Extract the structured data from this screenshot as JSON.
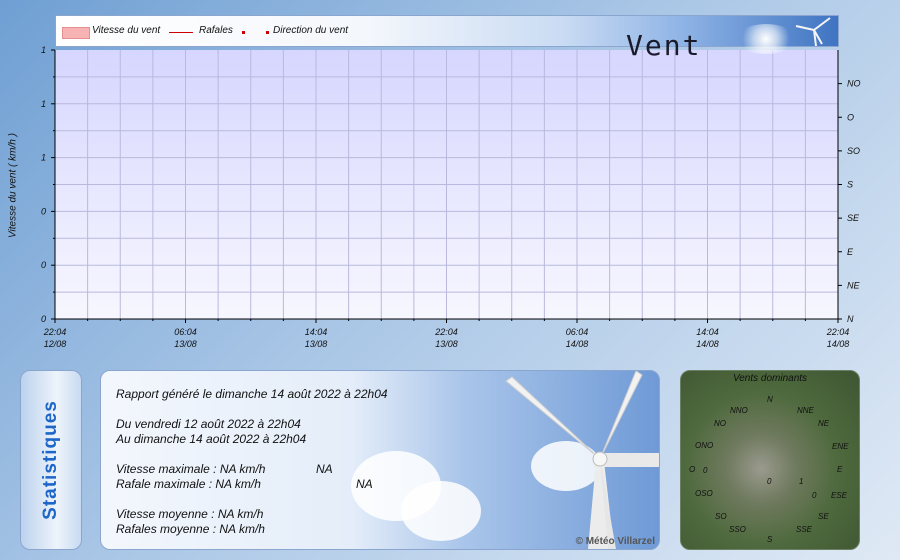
{
  "header": {
    "title": "Vent"
  },
  "legend": {
    "wind_speed": "Vitesse du vent",
    "gusts": "Rafales",
    "direction": "Direction du vent"
  },
  "colors": {
    "wind_speed": "#f7b3b3",
    "gusts": "#cc0000",
    "direction": "#cc0000",
    "plot_top": "#d6d6ff",
    "plot_bottom": "#f7f7ff"
  },
  "chart_data": {
    "type": "line",
    "ylabel": "Vitesse du vent ( km/h )",
    "left_ticks": [
      "0",
      "0",
      "0",
      "1",
      "1",
      "1"
    ],
    "right_ticks": [
      "N",
      "NE",
      "E",
      "SE",
      "S",
      "SO",
      "O",
      "NO"
    ],
    "x_ticks": [
      {
        "time": "22:04",
        "date": "12/08"
      },
      {
        "time": "06:04",
        "date": "13/08"
      },
      {
        "time": "14:04",
        "date": "13/08"
      },
      {
        "time": "22:04",
        "date": "13/08"
      },
      {
        "time": "06:04",
        "date": "14/08"
      },
      {
        "time": "14:04",
        "date": "14/08"
      },
      {
        "time": "22:04",
        "date": "14/08"
      }
    ],
    "series": [
      {
        "name": "Vitesse du vent",
        "values": []
      },
      {
        "name": "Rafales",
        "values": []
      },
      {
        "name": "Direction du vent",
        "values": []
      }
    ],
    "grid": true
  },
  "stats": {
    "side_label": "Statistiques",
    "generated": "Rapport généré le dimanche 14 août 2022 à 22h04",
    "from": "Du vendredi 12 août 2022 à 22h04",
    "to": "Au dimanche 14 août 2022 à 22h04",
    "max_speed": "Vitesse maximale : NA km/h",
    "max_speed_extra": "NA",
    "max_gust": "Rafale maximale : NA km/h",
    "max_gust_extra": "NA",
    "avg_speed": "Vitesse moyenne : NA km/h",
    "avg_gust": "Rafales moyenne : NA km/h",
    "copyright": "© Météo Villarzel"
  },
  "dominant": {
    "title": "Vents dominants",
    "labels": [
      "N",
      "NNE",
      "NE",
      "ENE",
      "E",
      "ESE",
      "SE",
      "SSE",
      "S",
      "SSO",
      "SO",
      "OSO",
      "O",
      "ONO",
      "NO",
      "NNO",
      "0",
      "0",
      "1",
      "0"
    ]
  }
}
